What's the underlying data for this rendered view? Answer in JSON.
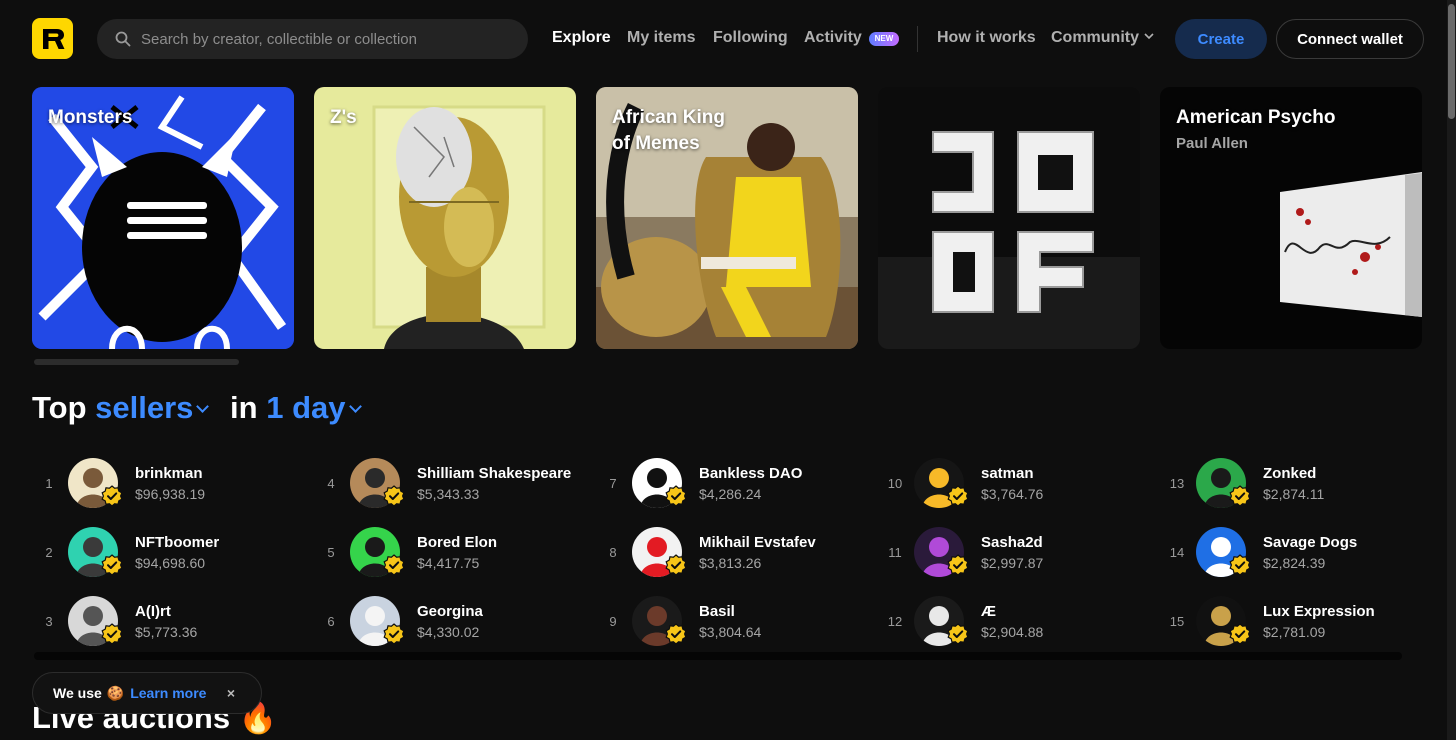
{
  "header": {
    "logo": "R",
    "search_placeholder": "Search by creator, collectible or collection",
    "nav": [
      "Explore",
      "My items",
      "Following",
      "Activity",
      "How it works",
      "Community"
    ],
    "activity_badge": "NEW",
    "create_label": "Create",
    "wallet_label": "Connect wallet"
  },
  "cards": [
    {
      "title": "Monsters",
      "subtitle": ""
    },
    {
      "title": "Z's",
      "subtitle": ""
    },
    {
      "title": "African King",
      "title2": "of Memes",
      "subtitle": ""
    },
    {
      "title": "",
      "subtitle": ""
    },
    {
      "title": "American Psycho",
      "subtitle": "Paul Allen"
    }
  ],
  "top_sellers": {
    "top": "Top",
    "sellers": "sellers",
    "in": "in",
    "period": "1 day",
    "items": [
      {
        "rank": "1",
        "name": "brinkman",
        "value": "$96,938.19"
      },
      {
        "rank": "2",
        "name": "NFTboomer",
        "value": "$94,698.60"
      },
      {
        "rank": "3",
        "name": "A(I)rt",
        "value": "$5,773.36"
      },
      {
        "rank": "4",
        "name": "Shilliam Shakespeare",
        "value": "$5,343.33"
      },
      {
        "rank": "5",
        "name": "Bored Elon",
        "value": "$4,417.75"
      },
      {
        "rank": "6",
        "name": "Georgina",
        "value": "$4,330.02"
      },
      {
        "rank": "7",
        "name": "Bankless DAO",
        "value": "$4,286.24"
      },
      {
        "rank": "8",
        "name": "Mikhail Evstafev",
        "value": "$3,813.26"
      },
      {
        "rank": "9",
        "name": "Basil",
        "value": "$3,804.64"
      },
      {
        "rank": "10",
        "name": "satman",
        "value": "$3,764.76"
      },
      {
        "rank": "11",
        "name": "Sasha2d",
        "value": "$2,997.87"
      },
      {
        "rank": "12",
        "name": "Æ",
        "value": "$2,904.88"
      },
      {
        "rank": "13",
        "name": "Zonked",
        "value": "$2,874.11"
      },
      {
        "rank": "14",
        "name": "Savage Dogs",
        "value": "$2,824.39"
      },
      {
        "rank": "15",
        "name": "Lux Expression",
        "value": "$2,781.09"
      }
    ]
  },
  "live_auctions": "Live auctions",
  "cookie": {
    "text": "We use",
    "learn": "Learn more",
    "close": "×"
  },
  "colors": {
    "accent": "#3d8bff",
    "brand": "#fed700",
    "background": "#0e0e0e"
  }
}
